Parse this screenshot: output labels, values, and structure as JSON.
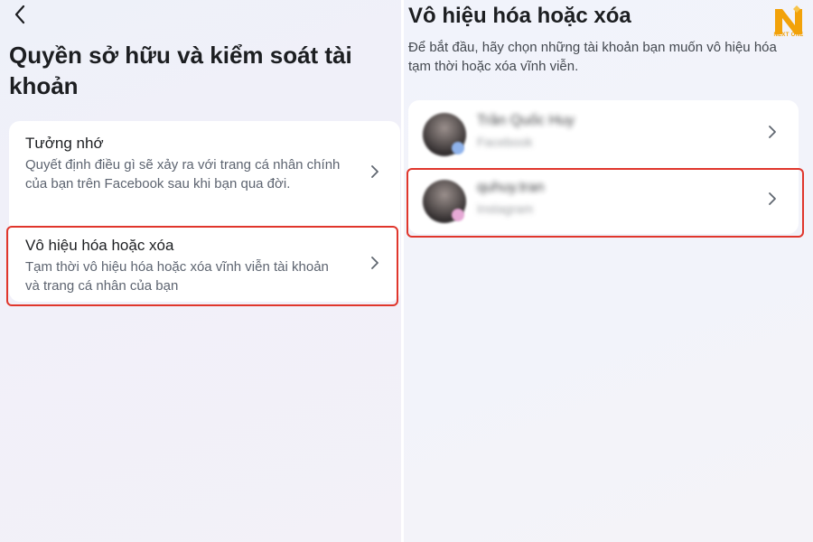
{
  "left": {
    "title": "Quyền sở hữu và kiểm soát tài khoản",
    "items": [
      {
        "title": "Tưởng nhớ",
        "description": "Quyết định điều gì sẽ xảy ra với trang cá nhân chính của bạn trên Facebook sau khi bạn qua đời."
      },
      {
        "title": "Vô hiệu hóa hoặc xóa",
        "description": "Tạm thời vô hiệu hóa hoặc xóa vĩnh viễn tài khoản và trang cá nhân của bạn"
      }
    ]
  },
  "right": {
    "title": "Vô hiệu hóa hoặc xóa",
    "subtitle": "Để bắt đầu, hãy chọn những tài khoản bạn muốn vô hiệu hóa tạm thời hoặc xóa vĩnh viễn.",
    "accounts": [
      {
        "name": "Trần Quốc Huy",
        "platform": "Facebook"
      },
      {
        "name": "quhuy.tran",
        "platform": "Instagram"
      }
    ]
  },
  "logo": {
    "text": "NEXT ONE"
  },
  "colors": {
    "highlight": "#e0362c",
    "logo": "#f2a20a"
  }
}
